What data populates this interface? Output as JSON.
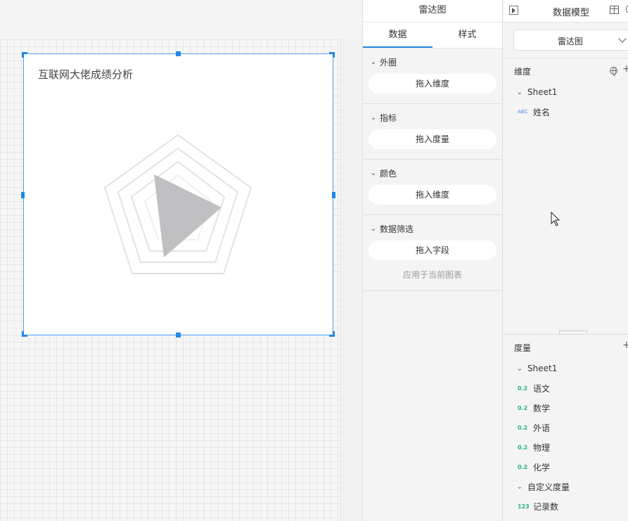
{
  "canvas": {
    "widget": {
      "title": "互联网大佬成绩分析"
    }
  },
  "config": {
    "header": "雷达图",
    "tabs": [
      {
        "label": "数据",
        "active": true
      },
      {
        "label": "样式",
        "active": false
      }
    ],
    "sections": [
      {
        "title": "外圈",
        "drop": "拖入维度"
      },
      {
        "title": "指标",
        "drop": "拖入度量"
      },
      {
        "title": "颜色",
        "drop": "拖入维度"
      },
      {
        "title": "数据筛选",
        "drop": "拖入字段",
        "apply": "应用于当前图表"
      }
    ]
  },
  "model": {
    "title": "数据模型",
    "selected": "雷达图",
    "dimension": {
      "title": "维度",
      "group": "Sheet1",
      "fields": [
        {
          "type": "ABC",
          "name": "姓名"
        }
      ]
    },
    "measure": {
      "title": "度量",
      "group": "Sheet1",
      "fields": [
        {
          "type": "0.2",
          "name": "语文"
        },
        {
          "type": "0.2",
          "name": "数学"
        },
        {
          "type": "0.2",
          "name": "外语"
        },
        {
          "type": "0.2",
          "name": "物理"
        },
        {
          "type": "0.2",
          "name": "化学"
        }
      ],
      "custom_group": "自定义度量",
      "custom_fields": [
        {
          "type": "123",
          "name": "记录数"
        }
      ]
    }
  },
  "colors": {
    "accent": "#1e88e5",
    "measure_tag": "#27b38a",
    "dimension_tag": "#4a8cf0",
    "radar_fill": "#c0c0c2",
    "radar_grid": "#e0e0e0"
  }
}
